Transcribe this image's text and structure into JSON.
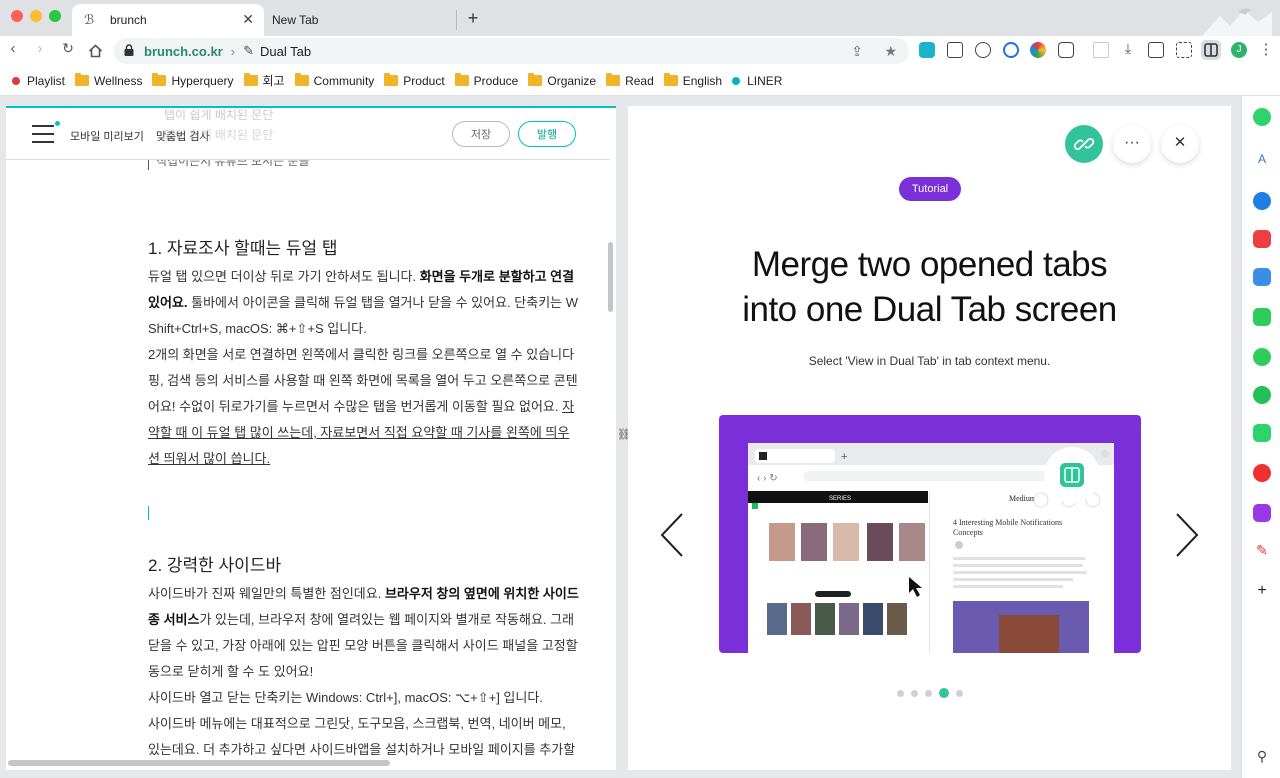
{
  "browser": {
    "tabs": [
      {
        "title": "brunch"
      },
      {
        "title": "New Tab"
      }
    ],
    "url_domain": "brunch.co.kr",
    "url_page": "Dual Tab",
    "bookmarks": [
      {
        "label": "Playlist",
        "type": "dot",
        "color": "#e53935"
      },
      {
        "label": "Wellness",
        "type": "folder"
      },
      {
        "label": "Hyperquery",
        "type": "folder"
      },
      {
        "label": "회고",
        "type": "folder"
      },
      {
        "label": "Community",
        "type": "folder"
      },
      {
        "label": "Product",
        "type": "folder"
      },
      {
        "label": "Produce",
        "type": "folder"
      },
      {
        "label": "Organize",
        "type": "folder"
      },
      {
        "label": "Read",
        "type": "folder"
      },
      {
        "label": "English",
        "type": "folder"
      },
      {
        "label": "LINER",
        "type": "dot",
        "color": "#00b4c6"
      }
    ],
    "profile_initial": "J"
  },
  "editor": {
    "mobile_preview": "모바일 미리보기",
    "spellcheck": "맞춤법 검사",
    "save": "저장",
    "publish": "발행",
    "ghost_lines": [
      "탭이 쉽게 배치된 문단",
      "탭이 쉽게 배치된 문단",
      "직접이든지 유튜브 보시는 문을"
    ],
    "section1": {
      "heading": "1. 자료조사 할때는 듀얼 탭",
      "l1a": "듀얼 탭 있으면 더이상 뒤로 가기 안하셔도 됩니다. ",
      "l1b": "화면을 두개로 분할하고 연결",
      "l2a": "있어요.",
      "l2b": " 툴바에서 아이콘을 클릭해 듀얼 탭을 열거나 닫을 수 있어요. 단축키는 W",
      "l3": "Shift+Ctrl+S, macOS: ⌘+⇧+S 입니다.",
      "l4": "2개의 화면을 서로 연결하면 왼쪽에서 클릭한 링크를 오른쪽으로 열 수 있습니다",
      "l5": "핑, 검색 등의 서비스를 사용할 때 왼쪽 화면에 목록을 열어 두고 오른쪽으로 콘텐",
      "l6a": "어요! 수없이 뒤로가기를 누르면서 수많은 탭을 번거롭게 이동할 필요 없어요. ",
      "l6b": "자",
      "l7": "약할 때 이 듀얼 탭 많이 쓰는데, 자료보면서 직접 요약할 때 기사를 왼쪽에 띄우",
      "l8": "션 띄워서 많이 씁니다."
    },
    "section2": {
      "heading": "2. 강력한 사이드바",
      "l1a": "사이드바가 진짜 웨일만의 특별한 점인데요. ",
      "l1b": "브라우저 창의 옆면에 위치한 사이드",
      "l2a": "종 서비스",
      "l2b": "가 있는데, 브라우저 창에 열려있는 웹 페이지와 별개로 작동해요. 그래",
      "l3": "닫을 수 있고, 가장 아래에 있는 압핀 모양 버튼을 클릭해서 사이드 패널을 고정할",
      "l4": "동으로 닫히게 할 수 도 있어요!",
      "l5": "사이드바 열고 닫는 단축키는 Windows: Ctrl+], macOS: ⌥+⇧+] 입니다.",
      "l6": "사이드바 메뉴에는 대표적으로 그린닷, 도구모음, 스크랩북, 번역, 네이버 메모,",
      "l7": "있는데요. 더 추가하고 싶다면 사이드바앱을 설치하거나 모바일 페이지를 추가할"
    }
  },
  "tutorial": {
    "badge": "Tutorial",
    "headline_1": "Merge two opened tabs",
    "headline_2": "into one Dual Tab screen",
    "subtitle": "Select 'View in Dual Tab' in tab context menu.",
    "slide_count": 5,
    "active_slide": 4,
    "mock": {
      "left_brand": "SERIES",
      "right_brand": "Medium",
      "article_title_1": "4 Interesting Mobile Notifications",
      "article_title_2": "Concepts"
    }
  },
  "colors": {
    "accent": "#31c39a",
    "brunch_teal": "#00c3bd",
    "badge_purple": "#7b2fd8"
  }
}
